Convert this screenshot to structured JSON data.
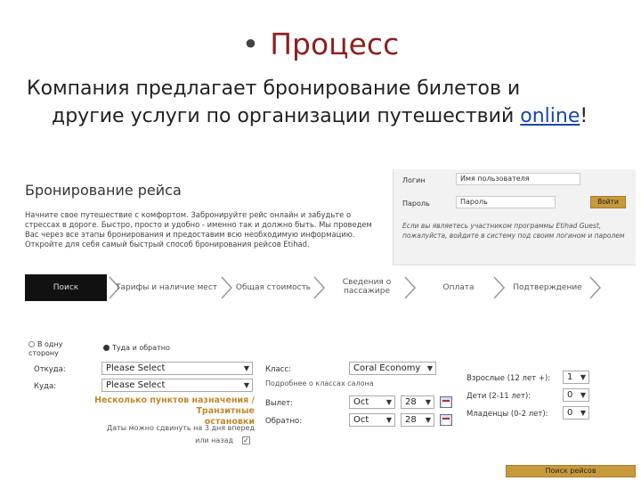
{
  "slide": {
    "bullet": "•",
    "title": "Процесс",
    "body_line1": "Компания предлагает бронирование билетов и",
    "body_line2_text": "другие услуги по организации путешествий ",
    "body_line2_link": "online",
    "body_line2_end": "!"
  },
  "booking": {
    "title": "Бронирование рейса",
    "description": "Начните свое путешествие с комфортом. Забронируйте рейс онлайн и забудьте о стрессах в дороге. Быстро, просто и удобно - именно так и должно быть. Мы проведем Вас через все этапы бронирования и предоставим всю необходимую информацию. Откройте для себя самый быстрый способ бронирования рейсов Etihad."
  },
  "login": {
    "login_label": "Логин",
    "login_placeholder": "Имя пользователя",
    "password_label": "Пароль",
    "password_placeholder": "Пароль",
    "button": "Войти",
    "note": "Если вы являетесь участником программы Etihad Guest, пожалуйста, войдите в систему под своим логином и паролем"
  },
  "steps": {
    "step1": "Поиск",
    "step2": "Тарифы и наличие мест",
    "step3": "Общая стоимость",
    "step4_a": "Сведения о",
    "step4_b": "пассажире",
    "step5": "Оплата",
    "step6": "Подтверждение"
  },
  "form": {
    "one_way_a": "В одну",
    "one_way_b": "сторону",
    "round_trip": "Туда и обратно",
    "from_label": "Откуда:",
    "from_value": "Please Select",
    "to_label": "Куда:",
    "to_value": "Please Select",
    "multi_a": "Несколько пунктов назначения / Транзитные",
    "multi_b": "остановки",
    "flex_a": "Даты можно сдвинуть на 3 дня вперед",
    "flex_b": "или назад",
    "class_label": "Класс:",
    "class_value": "Coral Economy",
    "class_hint": "Подробнее о классах салона",
    "depart_label": "Вылет:",
    "depart_month": "Oct",
    "depart_day": "28",
    "return_label": "Обратно:",
    "return_month": "Oct",
    "return_day": "28",
    "adults_label": "Взрослые (12 лет +):",
    "adults_value": "1",
    "children_label": "Дети (2-11 лет):",
    "children_value": "0",
    "infants_label": "Младенцы (0-2 лет):",
    "infants_value": "0",
    "search_button": "Поиск рейсов"
  },
  "colors": {
    "title_red": "#8e1f1f",
    "gold": "#c99a3d",
    "active_step": "#111111",
    "link_blue": "#1a47a5"
  }
}
